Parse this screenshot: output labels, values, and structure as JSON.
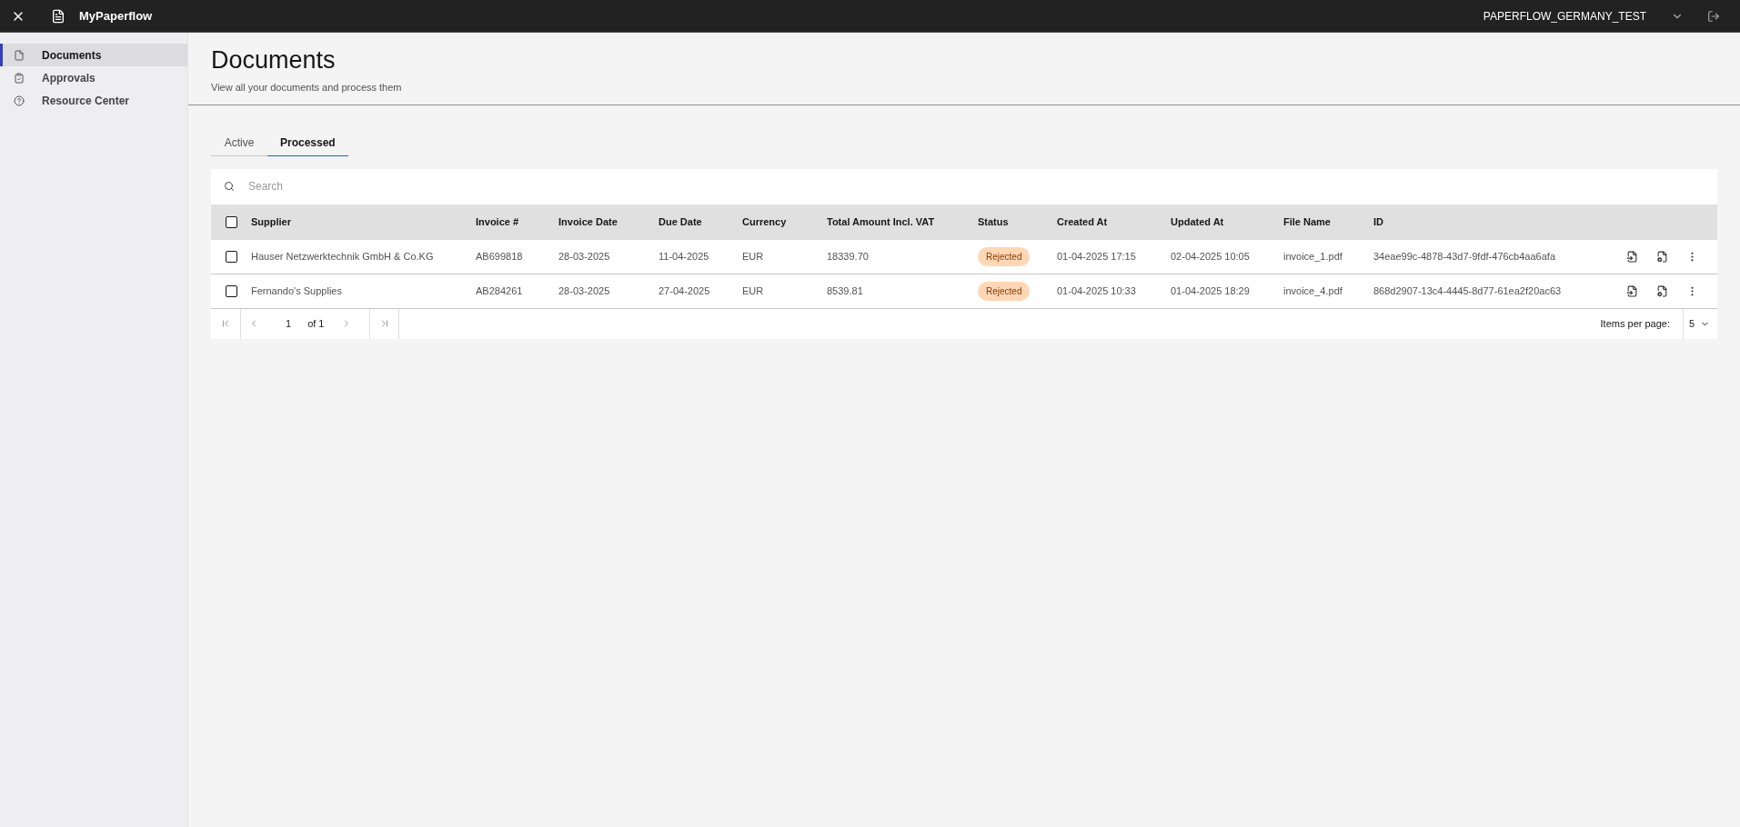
{
  "app": {
    "title": "MyPaperflow",
    "account": "PAPERFLOW_GERMANY_TEST"
  },
  "sidebar": {
    "items": [
      {
        "label": "Documents",
        "selected": true
      },
      {
        "label": "Approvals",
        "selected": false
      },
      {
        "label": "Resource Center",
        "selected": false
      }
    ]
  },
  "page": {
    "title": "Documents",
    "subtitle": "View all your documents and process them"
  },
  "tabs": [
    {
      "label": "Active",
      "selected": false
    },
    {
      "label": "Processed",
      "selected": true
    }
  ],
  "search": {
    "placeholder": "Search"
  },
  "table": {
    "columns": [
      "Supplier",
      "Invoice #",
      "Invoice Date",
      "Due Date",
      "Currency",
      "Total Amount Incl. VAT",
      "Status",
      "Created At",
      "Updated At",
      "File Name",
      "ID"
    ],
    "select_all_checked": false,
    "rows": [
      {
        "checked": false,
        "cells": [
          "Hauser Netzwerktechnik GmbH & Co.KG",
          "AB699818",
          "28-03-2025",
          "11-04-2025",
          "EUR",
          "18339.70",
          "Rejected",
          "01-04-2025 17:15",
          "02-04-2025 10:05",
          "invoice_1.pdf",
          "34eae99c-4878-43d7-9fdf-476cb4aa6afa"
        ]
      },
      {
        "checked": false,
        "cells": [
          "Fernando's Supplies",
          "AB284261",
          "28-03-2025",
          "27-04-2025",
          "EUR",
          "8539.81",
          "Rejected",
          "01-04-2025 10:33",
          "01-04-2025 18:29",
          "invoice_4.pdf",
          "868d2907-13c4-4445-8d77-61ea2f20ac63"
        ]
      }
    ]
  },
  "pagination": {
    "page": "1",
    "of": "of 1",
    "items_per_page_label": "Items per page:",
    "items_per_page": "5"
  }
}
